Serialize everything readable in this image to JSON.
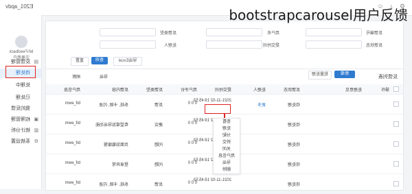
{
  "overlay": {
    "text": "bootstrapcarousel用户反馈"
  },
  "topbar": {
    "brand": "E201_apdv"
  },
  "sidebar": {
    "user_name": "bif-Feedback",
    "user_sub": "注册用户",
    "items": [
      {
        "label": "反馈管理",
        "active": false
      },
      {
        "label": "待处理",
        "active": true
      },
      {
        "label": "处理中",
        "active": false
      },
      {
        "label": "已处理",
        "active": false
      },
      {
        "label": "我的反馈",
        "active": false
      },
      {
        "label": "权限管理",
        "active": false
      },
      {
        "label": "统计分析",
        "active": false
      },
      {
        "label": "系统设置",
        "active": false
      }
    ]
  },
  "filters": {
    "labels": [
      "反馈编号",
      "用户名",
      "反馈类型",
      "反馈状态",
      "提交时间",
      "处理人"
    ],
    "search_label": "查询",
    "reset_label": "重置",
    "export_label": "导出Excel"
  },
  "table": {
    "title": "反馈列表",
    "toolbar": [
      "新增",
      "批量处理",
      "导出",
      "刷新"
    ],
    "headers": [
      "操作",
      "处理意见",
      "反馈状态",
      "处理人",
      "提交时间",
      "用户评价",
      "反馈类型",
      "反馈内容",
      "用户信息"
    ],
    "rows": [
      {
        "user": "bif_ewm",
        "content": "系统, 卡顿, 闪退",
        "type": "反馈",
        "status": "待处理",
        "time": "2021-11-02 19:45:53",
        "rating": "0 0 0",
        "handler": "未分配",
        "action": "更多"
      },
      {
        "user": "bif_ewm",
        "content": "希望增加导出功能",
        "type": "建议",
        "status": "待处理",
        "time": "2021-11-02 19:45:53",
        "rating": "0 0 0",
        "handler": "未分配",
        "action": "更多"
      },
      {
        "user": "bif_ewm",
        "content": "页面加载缓慢",
        "type": "问题",
        "status": "待处理",
        "time": "2021-11-02 19:45:53",
        "rating": "0 0 0",
        "handler": "未分配",
        "action": "更多"
      },
      {
        "user": "bif_ewm",
        "content": "登录异常",
        "type": "问题",
        "status": "待处理",
        "time": "2021-11-02 19:45:53",
        "rating": "0 0 0",
        "handler": "未分配",
        "action": "更多"
      },
      {
        "user": "bif_ewm",
        "content": "系统, 卡顿, 闪退",
        "type": "反馈",
        "status": "待处理",
        "time": "2021-11-02 19:45:53",
        "rating": "0 0 0",
        "handler": "未分配",
        "action": "更多"
      }
    ]
  },
  "dropdown": {
    "items": [
      "查看",
      "处理",
      "分配",
      "转交",
      "关闭",
      "用户信息",
      "导出",
      "删除"
    ]
  },
  "colors": {
    "accent": "#2f7bd0",
    "highlight": "#e02020"
  }
}
